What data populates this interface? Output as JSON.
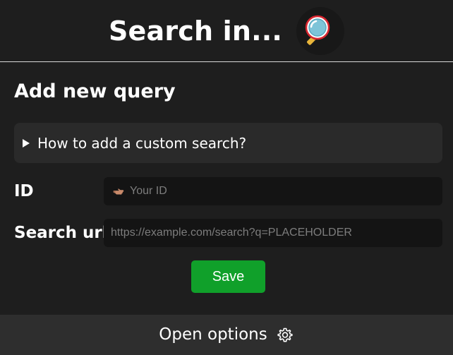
{
  "header": {
    "title": "Search in...",
    "logo_icon": "magnifier-icon"
  },
  "form": {
    "section_title": "Add new query",
    "help_summary": "How to add a custom search?",
    "id_label": "ID",
    "id_placeholder": "Your ID",
    "id_icon": "pointing-hand-icon",
    "url_label": "Search url",
    "url_placeholder": "https://example.com/search?q=PLACEHOLDER",
    "save_label": "Save"
  },
  "footer": {
    "open_options_label": "Open options",
    "icon": "gear-icon"
  },
  "colors": {
    "background": "#1e1e1e",
    "panel": "#2a2a2a",
    "input": "#141414",
    "save_button": "#10a02a",
    "footer": "#2e2e2e"
  }
}
